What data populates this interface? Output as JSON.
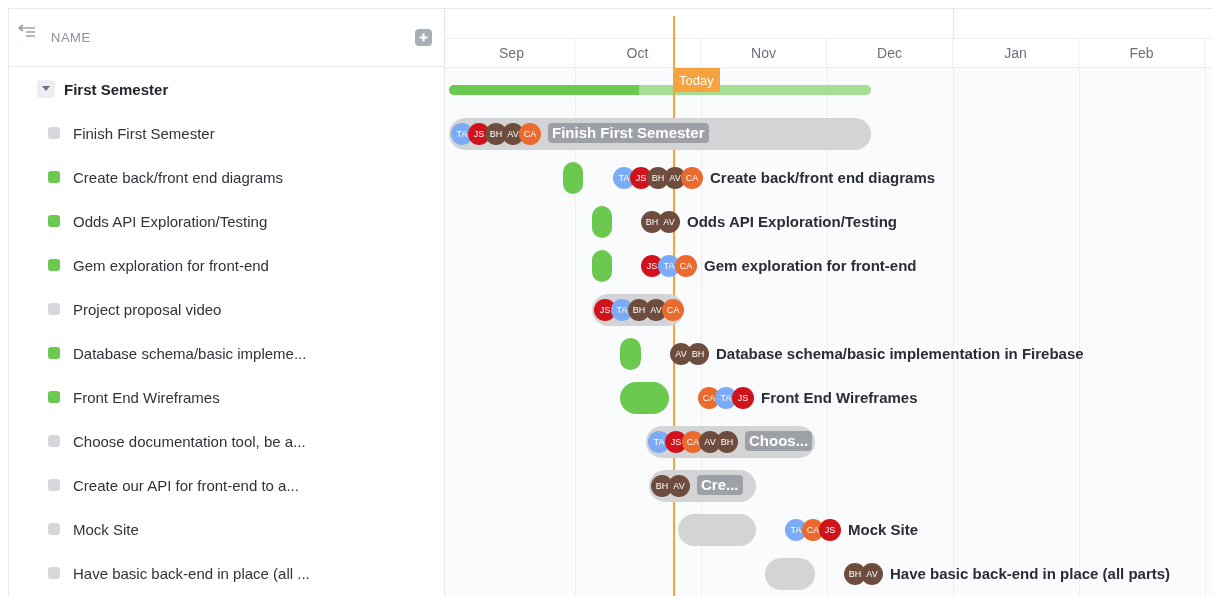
{
  "task_list": {
    "column_header": "NAME",
    "group": {
      "name": "First Semester",
      "expanded": true,
      "tasks": [
        {
          "name": "Finish First Semester",
          "complete": false
        },
        {
          "name": "Create back/front end diagrams",
          "complete": true
        },
        {
          "name": "Odds API Exploration/Testing",
          "complete": true
        },
        {
          "name": "Gem exploration for front-end",
          "complete": true
        },
        {
          "name": "Project proposal video",
          "complete": false
        },
        {
          "name": "Database schema/basic impleme...",
          "complete": true
        },
        {
          "name": "Front End Wireframes",
          "complete": true
        },
        {
          "name": "Choose documentation tool, be a...",
          "complete": false
        },
        {
          "name": "Create our API for front-end to a...",
          "complete": false
        },
        {
          "name": "Mock Site",
          "complete": false
        },
        {
          "name": "Have basic back-end in place (all ...",
          "complete": false
        }
      ]
    }
  },
  "timeline": {
    "months": [
      "Sep",
      "Oct",
      "Nov",
      "Dec",
      "Jan",
      "Feb"
    ],
    "today_label": "Today",
    "group_progress": {
      "level": 0.45
    },
    "bars": [
      {
        "label": "Finish First Semester",
        "complete": false,
        "label_inside": true,
        "assignees": [
          {
            "initials": "TA",
            "color": "#7baaf7"
          },
          {
            "initials": "JS",
            "color": "#d0131b"
          },
          {
            "initials": "BH",
            "color": "#6e4c3e"
          },
          {
            "initials": "AV",
            "color": "#6e4c3e"
          },
          {
            "initials": "CA",
            "color": "#ea6a2f"
          }
        ]
      },
      {
        "label": "Create back/front end diagrams",
        "complete": true,
        "label_inside": false,
        "assignees": [
          {
            "initials": "TA",
            "color": "#7baaf7"
          },
          {
            "initials": "JS",
            "color": "#d0131b"
          },
          {
            "initials": "BH",
            "color": "#6e4c3e"
          },
          {
            "initials": "AV",
            "color": "#6e4c3e"
          },
          {
            "initials": "CA",
            "color": "#ea6a2f"
          }
        ]
      },
      {
        "label": "Odds API Exploration/Testing",
        "complete": true,
        "label_inside": false,
        "assignees": [
          {
            "initials": "BH",
            "color": "#6e4c3e"
          },
          {
            "initials": "AV",
            "color": "#6e4c3e"
          }
        ]
      },
      {
        "label": "Gem exploration for front-end",
        "complete": true,
        "label_inside": false,
        "assignees": [
          {
            "initials": "JS",
            "color": "#d0131b"
          },
          {
            "initials": "TA",
            "color": "#7baaf7"
          },
          {
            "initials": "CA",
            "color": "#ea6a2f"
          }
        ]
      },
      {
        "complete": false,
        "label_inside": true,
        "assignees": [
          {
            "initials": "JS",
            "color": "#d0131b"
          },
          {
            "initials": "TA",
            "color": "#7baaf7"
          },
          {
            "initials": "BH",
            "color": "#6e4c3e"
          },
          {
            "initials": "AV",
            "color": "#6e4c3e"
          },
          {
            "initials": "CA",
            "color": "#ea6a2f"
          }
        ]
      },
      {
        "label": "Database schema/basic implementation in Firebase",
        "complete": true,
        "label_inside": false,
        "assignees": [
          {
            "initials": "AV",
            "color": "#6e4c3e"
          },
          {
            "initials": "BH",
            "color": "#6e4c3e"
          }
        ]
      },
      {
        "label": "Front End Wireframes",
        "complete": true,
        "label_inside": false,
        "assignees": [
          {
            "initials": "CA",
            "color": "#ea6a2f"
          },
          {
            "initials": "TA",
            "color": "#7baaf7"
          },
          {
            "initials": "JS",
            "color": "#d0131b"
          }
        ]
      },
      {
        "label": "Choos...",
        "complete": false,
        "label_inside": true,
        "assignees": [
          {
            "initials": "TA",
            "color": "#7baaf7"
          },
          {
            "initials": "JS",
            "color": "#d0131b"
          },
          {
            "initials": "CA",
            "color": "#ea6a2f"
          },
          {
            "initials": "AV",
            "color": "#6e4c3e"
          },
          {
            "initials": "BH",
            "color": "#6e4c3e"
          }
        ]
      },
      {
        "label": "Cre...",
        "complete": false,
        "label_inside": true,
        "assignees": [
          {
            "initials": "BH",
            "color": "#6e4c3e"
          },
          {
            "initials": "AV",
            "color": "#6e4c3e"
          }
        ]
      },
      {
        "label": "Mock Site",
        "complete": false,
        "label_inside": false,
        "assignees": [
          {
            "initials": "TA",
            "color": "#7baaf7"
          },
          {
            "initials": "CA",
            "color": "#ea6a2f"
          },
          {
            "initials": "JS",
            "color": "#d0131b"
          }
        ]
      },
      {
        "label": "Have basic back-end in place (all parts)",
        "complete": false,
        "label_inside": false,
        "assignees": [
          {
            "initials": "BH",
            "color": "#6e4c3e"
          },
          {
            "initials": "AV",
            "color": "#6e4c3e"
          }
        ]
      }
    ]
  }
}
